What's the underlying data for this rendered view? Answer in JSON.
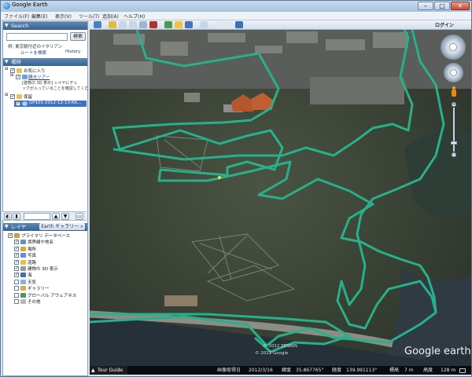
{
  "window": {
    "title": "Google Earth"
  },
  "menu": [
    "ファイル(F)",
    "編集(E)",
    "表示(V)",
    "ツール(T)",
    "追加(A)",
    "ヘルプ(H)"
  ],
  "search": {
    "header": "Search",
    "placeholder": "",
    "button": "検索",
    "hint": "例: 東京駅付近のイタリアン",
    "directions": "ルートを検索",
    "history": "History"
  },
  "places": {
    "header": "場所",
    "items": [
      {
        "label": "お気に入り",
        "checked": true
      },
      {
        "label": "観光ツアー",
        "checked": true
      },
      {
        "label": "[建物の 3D 表示] レイヤにチェ",
        "checked": false
      },
      {
        "label": "ックが入っていることを確認してくだ",
        "checked": false
      },
      {
        "label": "保留",
        "checked": true
      },
      {
        "label": "GP101-2012-12-13-Kit...",
        "checked": true
      }
    ]
  },
  "layers": {
    "header": "レイヤ",
    "gallery": "Earth ギャラリー",
    "items": [
      {
        "label": "プライマリ データベース",
        "checked": true
      },
      {
        "label": "境界線や地名",
        "checked": true
      },
      {
        "label": "場所",
        "checked": true
      },
      {
        "label": "写真",
        "checked": true
      },
      {
        "label": "道路",
        "checked": true
      },
      {
        "label": "建物の 3D 表示",
        "checked": true
      },
      {
        "label": "海",
        "checked": true
      },
      {
        "label": "天気",
        "checked": false
      },
      {
        "label": "ギャラリー",
        "checked": false
      },
      {
        "label": "グローバル アウェアネス",
        "checked": false
      },
      {
        "label": "その他",
        "checked": false
      }
    ]
  },
  "toolbar": {
    "login": "ログイン"
  },
  "map": {
    "copyright1": "© 2012 ZENRIN",
    "copyright2": "© 2012 Google",
    "logo": "Google earth",
    "tour_guide": "Tour Guide",
    "status": {
      "imagery_date_label": "画像取得日",
      "imagery_date": "2012/3/16",
      "lat_label": "緯度",
      "lat": "35.867765°",
      "lon_label": "経度",
      "lon": "139.991113°",
      "elev_label": "標高",
      "elev": "7 m",
      "eye_label": "高度",
      "eye": "128 m"
    },
    "track_color": "#27b08a"
  }
}
